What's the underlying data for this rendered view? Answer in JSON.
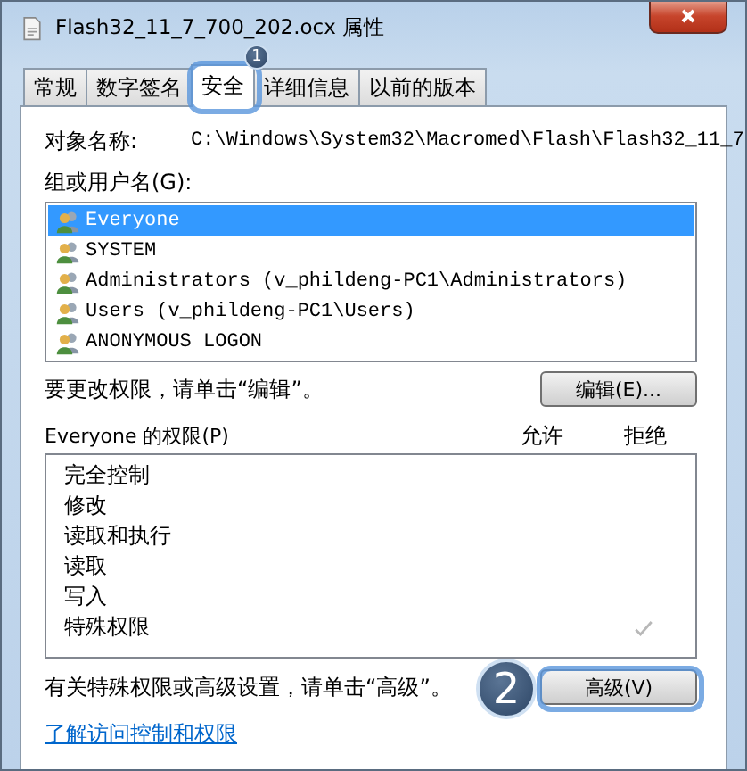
{
  "window": {
    "title": "Flash32_11_7_700_202.ocx 属性"
  },
  "tabs": [
    {
      "label": "常规",
      "selected": false
    },
    {
      "label": "数字签名",
      "selected": false
    },
    {
      "label": "安全",
      "selected": true
    },
    {
      "label": "详细信息",
      "selected": false
    },
    {
      "label": "以前的版本",
      "selected": false
    }
  ],
  "object_name": {
    "label": "对象名称:",
    "value": "C:\\Windows\\System32\\Macromed\\Flash\\Flash32_11_7"
  },
  "groups": {
    "label": "组或用户名(G):",
    "items": [
      {
        "name": "Everyone",
        "selected": true
      },
      {
        "name": "SYSTEM",
        "selected": false
      },
      {
        "name": "Administrators (v_phildeng-PC1\\Administrators)",
        "selected": false
      },
      {
        "name": "Users (v_phildeng-PC1\\Users)",
        "selected": false
      },
      {
        "name": "ANONYMOUS LOGON",
        "selected": false
      }
    ]
  },
  "edit_hint": "要更改权限，请单击“编辑”。",
  "edit_button": "编辑(E)...",
  "permissions": {
    "label": "Everyone 的权限(P)",
    "allow_header": "允许",
    "deny_header": "拒绝",
    "rows": [
      {
        "name": "完全控制",
        "allow": false,
        "deny": false
      },
      {
        "name": "修改",
        "allow": false,
        "deny": false
      },
      {
        "name": "读取和执行",
        "allow": false,
        "deny": false
      },
      {
        "name": "读取",
        "allow": false,
        "deny": false
      },
      {
        "name": "写入",
        "allow": false,
        "deny": false
      },
      {
        "name": "特殊权限",
        "allow": false,
        "deny": true
      }
    ]
  },
  "advanced_hint": "有关特殊权限或高级设置，请单击“高级”。",
  "advanced_button": "高级(V)",
  "link": "了解访问控制和权限",
  "callouts": [
    {
      "label": "1"
    },
    {
      "label": "2"
    }
  ]
}
